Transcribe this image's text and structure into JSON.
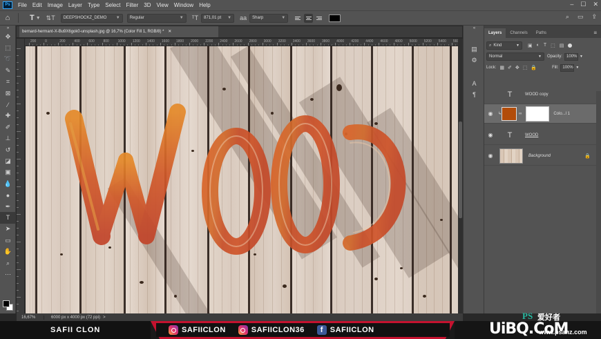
{
  "menu": [
    "File",
    "Edit",
    "Image",
    "Layer",
    "Type",
    "Select",
    "Filter",
    "3D",
    "View",
    "Window",
    "Help"
  ],
  "options": {
    "font_family": "DEEPSHOCKZ_DEMO",
    "font_style": "Regular",
    "font_size": "871,01 pt",
    "antialias_icon": "aa",
    "antialias": "Sharp",
    "text_color": "#000000"
  },
  "document": {
    "tab_title": "bernard-hermant-X-Bu9X6gok0-unsplash.jpg @ 16,7% (Color Fill 1, RGB/8) *"
  },
  "ruler_labels": [
    "200",
    "0",
    "200",
    "400",
    "600",
    "800",
    "1000",
    "1200",
    "1400",
    "1600",
    "1800",
    "2000",
    "2200",
    "2400",
    "2600",
    "2800",
    "3000",
    "3200",
    "3400",
    "3600",
    "3800",
    "4000",
    "4200",
    "4400",
    "4600",
    "4800",
    "5000",
    "5200",
    "5400",
    "5600",
    "5800"
  ],
  "status": {
    "zoom": "16,67%",
    "info": "6000 px x 4000 px (72 ppi)",
    "arrow": ">"
  },
  "canvas_text": "WOOD",
  "layers_panel": {
    "tabs": [
      "Layers",
      "Channels",
      "Paths"
    ],
    "kind_label": "Kind",
    "blend_mode": "Normal",
    "opacity_label": "Opacity:",
    "opacity_value": "100%",
    "lock_label": "Lock:",
    "fill_label": "Fill:",
    "fill_value": "100%",
    "layers": [
      {
        "name": "WOOD copy",
        "kind": "type",
        "visible": false
      },
      {
        "name": "Colo...l 1",
        "kind": "fill",
        "visible": true,
        "fill_color": "#b24c0a"
      },
      {
        "name": "WOOD",
        "kind": "type",
        "visible": true
      },
      {
        "name": "Background",
        "kind": "image",
        "visible": true,
        "locked": true
      }
    ]
  },
  "banner": {
    "left_name": "SAFII CLON",
    "instagram_1": "SAFIICLON",
    "instagram_2": "SAFIICLON36",
    "facebook": "SAFIICLON"
  },
  "watermark": {
    "ps": "PS",
    "cn": "爱好者",
    "site": "UiBQ.CoM",
    "url": "www.psahz.com"
  },
  "colors": {
    "ui_dark": "#535353",
    "panel_dark": "#3c3c3c",
    "banner_red": "#c4122f",
    "wood_paint": "#c9502a"
  }
}
